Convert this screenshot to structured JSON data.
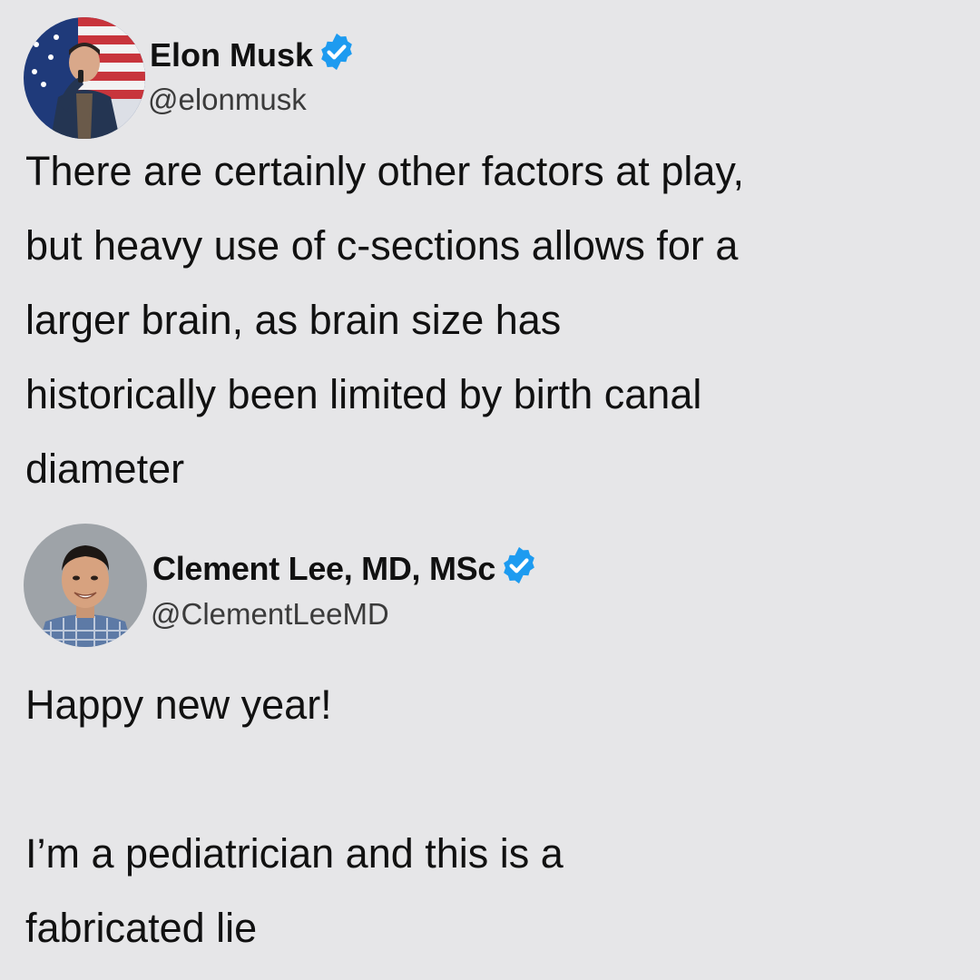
{
  "tweets": [
    {
      "display_name": "Elon Musk",
      "handle": "@elonmusk",
      "verified": true,
      "avatar_icon": "profile-photo-elon",
      "text_lines": [
        "There are certainly other factors at play,",
        "but heavy use of c-sections allows for a",
        "larger brain, as brain size has",
        "historically been limited by birth canal",
        "diameter"
      ]
    },
    {
      "display_name": "Clement Lee, MD, MSc",
      "handle": "@ClementLeeMD",
      "verified": true,
      "avatar_icon": "profile-photo-clement",
      "text_lines": [
        "Happy new year!",
        "",
        "I’m a pediatrician and this is a",
        "fabricated lie"
      ]
    }
  ],
  "colors": {
    "background": "#e6e6e8",
    "verified_badge": "#1d9bf0",
    "text": "#111111",
    "handle": "#3b3b3b"
  }
}
